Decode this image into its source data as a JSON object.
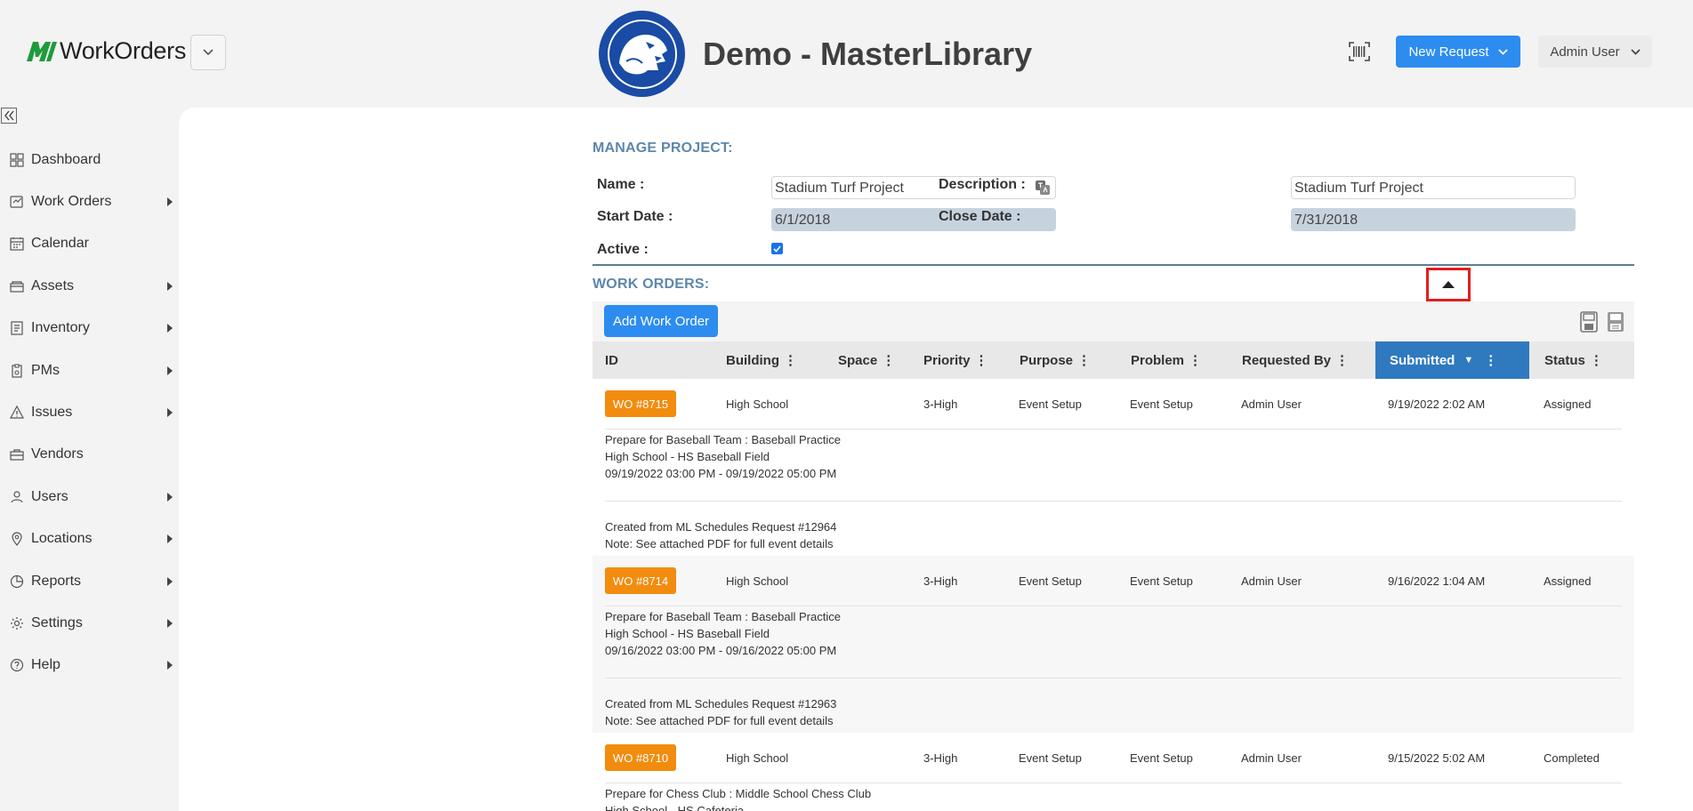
{
  "header": {
    "app_name": "WorkOrders",
    "site_title": "Demo - MasterLibrary",
    "new_request_label": "New Request",
    "user_label": "Admin User"
  },
  "sidebar": {
    "items": [
      {
        "label": "Dashboard",
        "icon": "dashboard-icon",
        "expandable": false
      },
      {
        "label": "Work Orders",
        "icon": "work-orders-icon",
        "expandable": true
      },
      {
        "label": "Calendar",
        "icon": "calendar-icon",
        "expandable": false
      },
      {
        "label": "Assets",
        "icon": "assets-icon",
        "expandable": true
      },
      {
        "label": "Inventory",
        "icon": "inventory-icon",
        "expandable": true
      },
      {
        "label": "PMs",
        "icon": "pms-icon",
        "expandable": true
      },
      {
        "label": "Issues",
        "icon": "warning-icon",
        "expandable": true
      },
      {
        "label": "Vendors",
        "icon": "briefcase-icon",
        "expandable": false
      },
      {
        "label": "Users",
        "icon": "users-icon",
        "expandable": true
      },
      {
        "label": "Locations",
        "icon": "location-pin-icon",
        "expandable": true
      },
      {
        "label": "Reports",
        "icon": "pie-chart-icon",
        "expandable": true
      },
      {
        "label": "Settings",
        "icon": "gear-icon",
        "expandable": true
      },
      {
        "label": "Help",
        "icon": "help-icon",
        "expandable": true
      }
    ]
  },
  "project": {
    "section_title": "MANAGE PROJECT:",
    "name_label": "Name :",
    "name_value": "Stadium Turf Project",
    "description_label": "Description :",
    "description_value": "Stadium Turf Project",
    "start_label": "Start Date :",
    "start_value": "6/1/2018",
    "close_label": "Close Date :",
    "close_value": "7/31/2018",
    "active_label": "Active :",
    "active": true
  },
  "work_orders": {
    "section_title": "WORK ORDERS:",
    "add_button": "Add Work Order",
    "columns": [
      "ID",
      "Building",
      "Space",
      "Priority",
      "Purpose",
      "Problem",
      "Requested By",
      "Submitted",
      "Status"
    ],
    "sorted_column": "Submitted",
    "rows": [
      {
        "id": "WO #8715",
        "building": "High School",
        "space": "",
        "priority": "3-High",
        "purpose": "Event Setup",
        "problem": "Event Setup",
        "requested_by": "Admin User",
        "submitted": "9/19/2022 2:02 AM",
        "status": "Assigned",
        "desc_1": "Prepare for Baseball Team : Baseball Practice",
        "desc_2": "High School - HS Baseball Field",
        "desc_3": "09/19/2022 03:00 PM - 09/19/2022 05:00 PM",
        "note_1": "Created from ML Schedules Request #12964",
        "note_2": "Note: See attached PDF for full event details"
      },
      {
        "id": "WO #8714",
        "building": "High School",
        "space": "",
        "priority": "3-High",
        "purpose": "Event Setup",
        "problem": "Event Setup",
        "requested_by": "Admin User",
        "submitted": "9/16/2022 1:04 AM",
        "status": "Assigned",
        "desc_1": "Prepare for Baseball Team : Baseball Practice",
        "desc_2": "High School - HS Baseball Field",
        "desc_3": "09/16/2022 03:00 PM - 09/16/2022 05:00 PM",
        "note_1": "Created from ML Schedules Request #12963",
        "note_2": "Note: See attached PDF for full event details"
      },
      {
        "id": "WO #8710",
        "building": "High School",
        "space": "",
        "priority": "3-High",
        "purpose": "Event Setup",
        "problem": "Event Setup",
        "requested_by": "Admin User",
        "submitted": "9/15/2022 5:02 AM",
        "status": "Completed",
        "desc_1": "Prepare for Chess Club : Middle School Chess Club",
        "desc_2": "High School - HS Cafeteria"
      }
    ]
  },
  "colors": {
    "accent_blue": "#2d8cf0",
    "sorted_header": "#2f79bf",
    "wo_badge": "#f28c0f",
    "section_title": "#5e87ad",
    "highlight": "#e41e1e"
  }
}
